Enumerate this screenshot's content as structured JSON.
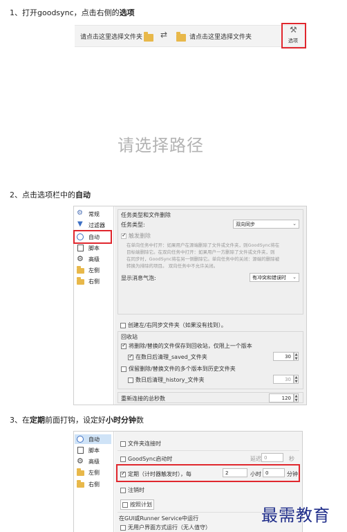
{
  "steps": [
    {
      "num": "1、",
      "text": "打开goodsync，点击右侧的",
      "bold": "选项"
    },
    {
      "num": "2、",
      "text": "点击选项栏中的",
      "bold": "自动"
    },
    {
      "num": "3、",
      "text": "在",
      "bold": "定期",
      "text2": "前面打钩，设定好",
      "bold2": "小时分钟",
      "text3": "数"
    }
  ],
  "step1": {
    "left_folder": "请点击这里选择文件夹",
    "right_folder": "请点击这里选择文件夹",
    "options_label": "选项",
    "empty_hint": "请选择路径"
  },
  "sidebar": {
    "items": [
      "常规",
      "过滤器",
      "自动",
      "脚本",
      "高级",
      "左侧",
      "右侧"
    ]
  },
  "panel2": {
    "group_title": "任务类型和文件删除",
    "task_type_label": "任务类型:",
    "task_type_value": "双向同步",
    "propagate_label": "触发删除",
    "desc1": "在单向任务中打开：如果用户在源端删除了文件或文件夹，则GoodSync将在",
    "desc2": "目标端删除它。在双向任务中打开：如果用户一方删除了文件或文件夹，则",
    "desc3": "在同步时，GoodSync将在另一侧删除它。单向任务中的关闭：源端的删除被",
    "desc4": "转换为排除的项目。 双向任务中不允许关闭。",
    "bubble_label": "显示消息气泡:",
    "bubble_value": "有冲突和错误时",
    "create_left_right": "创建左/右同步文件夹（如果没有找到）。",
    "recycle_title": "回收站",
    "save_deleted": "将删除/替换的文件保存到回收站，仅限上一个版本",
    "clean_saved": "在数日后清理_saved_文件夹",
    "clean_saved_days": "30",
    "keep_history": "保留删除/替换文件的多个版本到历史文件夹",
    "clean_history": "数日后清理_history_文件夹",
    "clean_history_days": "30",
    "reconnect_label": "重新连接的总秒数",
    "reconnect_value": "120"
  },
  "panel3": {
    "on_file_change": "文件夹连接时",
    "on_start": "GoodSync启动时",
    "delay_label": "延迟",
    "delay_value": "0",
    "delay_unit": "秒",
    "periodic_label": "定期（计时器触发时），每",
    "hours_value": "2",
    "hours_unit": "小时",
    "minutes_value": "0",
    "minutes_unit": "分钟",
    "on_logoff": "注销时",
    "schedule": "按照计划",
    "runner_title": "在GUI或Runner Service中运行",
    "no_ui": "无用户界面方式运行（无人值守）"
  },
  "watermark": "最需教育",
  "colors": {
    "accent_red": "#e0262d",
    "folder": "#e8b84a",
    "watermark": "#1f2d8a"
  }
}
